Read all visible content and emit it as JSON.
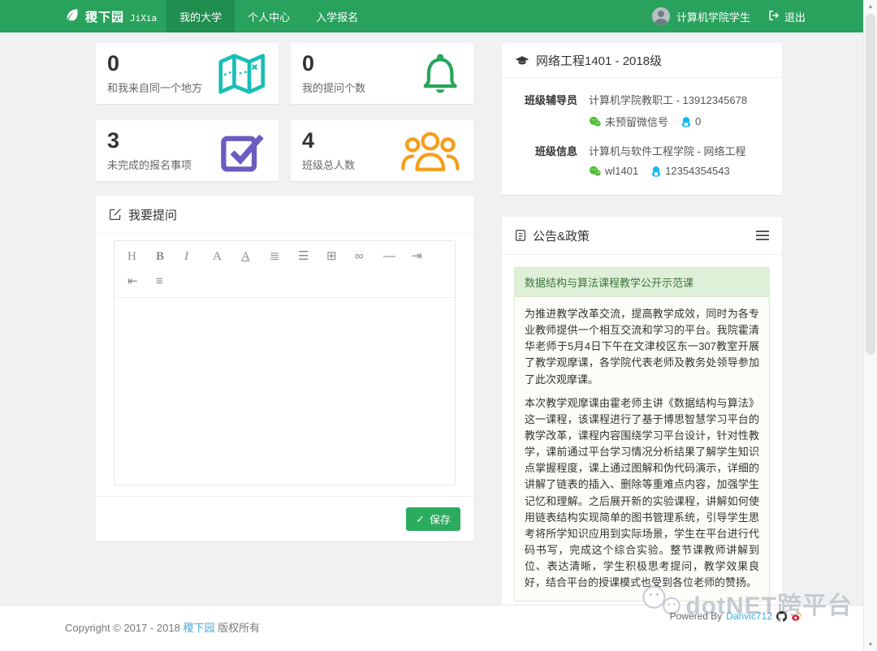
{
  "navbar": {
    "brand": {
      "name": "稷下园",
      "sub": "JiXia"
    },
    "items": [
      {
        "label": "我的大学",
        "active": true
      },
      {
        "label": "个人中心",
        "active": false
      },
      {
        "label": "入学报名",
        "active": false
      }
    ],
    "user_name": "计算机学院学生",
    "logout_label": "退出"
  },
  "stats": [
    {
      "value": "0",
      "label": "和我来自同一个地方",
      "icon": "map-icon",
      "color": "#17bfb6"
    },
    {
      "value": "0",
      "label": "我的提问个数",
      "icon": "bell-icon",
      "color": "#27a65b"
    },
    {
      "value": "3",
      "label": "未完成的报名事项",
      "icon": "check-square-icon",
      "color": "#6a5cc0"
    },
    {
      "value": "4",
      "label": "班级总人数",
      "icon": "users-icon",
      "color": "#f59e1c"
    }
  ],
  "class_panel": {
    "title": "网络工程1401 - 2018级",
    "rows": [
      {
        "label": "班级辅导员",
        "text": "计算机学院教职工 - 13912345678",
        "wechat": "未预留微信号",
        "qq": "0"
      },
      {
        "label": "班级信息",
        "text": "计算机与软件工程学院 - 网络工程",
        "wechat": "wl1401",
        "qq": "12354354543"
      }
    ]
  },
  "question_panel": {
    "title": "我要提问",
    "toolbar": [
      {
        "name": "heading-icon",
        "glyph": "H"
      },
      {
        "name": "bold-icon",
        "glyph": "B"
      },
      {
        "name": "italic-icon",
        "glyph": "I"
      },
      {
        "name": "font-color-icon",
        "glyph": "A"
      },
      {
        "name": "underline-icon",
        "glyph": "A"
      },
      {
        "name": "ordered-list-icon",
        "glyph": "≣"
      },
      {
        "name": "unordered-list-icon",
        "glyph": "☰"
      },
      {
        "name": "table-icon",
        "glyph": "⊞"
      },
      {
        "name": "link-icon",
        "glyph": "∞"
      },
      {
        "name": "horizontal-rule-icon",
        "glyph": "—"
      },
      {
        "name": "indent-icon",
        "glyph": "⇥"
      },
      {
        "name": "outdent-icon",
        "glyph": "⇤"
      },
      {
        "name": "align-icon",
        "glyph": "≡"
      }
    ],
    "editor_value": "",
    "save_label": "保存",
    "save_check": "✓"
  },
  "announcement_panel": {
    "title": "公告&政策",
    "notice_title": "数据结构与算法课程教学公开示范课",
    "paragraphs": [
      "为推进教学改革交流，提高教学成效，同时为各专业教师提供一个相互交流和学习的平台。我院霍清华老师于5月4日下午在文津校区东一307教室开展了教学观摩课，各学院代表老师及教务处领导参加了此次观摩课。",
      "本次教学观摩课由霍老师主讲《数据结构与算法》这一课程，该课程进行了基于博思智慧学习平台的教学改革，课程内容围绕学习平台设计，针对性教学，课前通过平台学习情况分析结果了解学生知识点掌握程度，课上通过图解和伪代码演示，详细的讲解了链表的插入、删除等重难点内容，加强学生记忆和理解。之后展开新的实验课程，讲解如何使用链表结构实现简单的图书管理系统，引导学生思考将所学知识应用到实际场景，学生在平台进行代码书写，完成这个综合实验。整节课教师讲解到位、表达清晰，学生积极思考提问，教学效果良好，结合平台的授课模式也受到各位老师的赞扬。"
    ]
  },
  "footer": {
    "copyright_prefix": "Copyright © 2017 - 2018",
    "brand_link": "稷下园",
    "copyright_suffix": "版权所有",
    "powered_prefix": "Powered By",
    "powered_link": "Danvic712",
    "watermark": "dotNET跨平台"
  },
  "colors": {
    "navbar_green": "#29a25d",
    "navbar_active_green": "#1f8e4e",
    "save_button_green": "#2bab5e",
    "link_blue": "#47a7dc",
    "wechat_green": "#4dbe2f",
    "qq_blue": "#12b7f5",
    "notice_header_bg": "#dff0d8",
    "notice_header_text": "#3c763d"
  }
}
